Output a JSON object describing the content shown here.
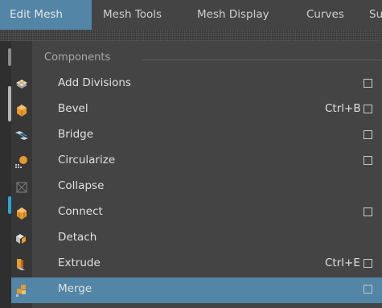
{
  "menubar": {
    "items": [
      {
        "label": "Edit Mesh",
        "active": true
      },
      {
        "label": "Mesh Tools"
      },
      {
        "label": "Mesh Display"
      },
      {
        "label": "Curves"
      },
      {
        "label": "Su"
      }
    ]
  },
  "dropdown": {
    "section_label": "Components",
    "items": [
      {
        "label": "Add Divisions",
        "shortcut": "",
        "icon": "add-divisions-icon",
        "option_box": true
      },
      {
        "label": "Bevel",
        "shortcut": "Ctrl+B",
        "icon": "bevel-icon",
        "option_box": true
      },
      {
        "label": "Bridge",
        "shortcut": "",
        "icon": "bridge-icon",
        "option_box": true
      },
      {
        "label": "Circularize",
        "shortcut": "",
        "icon": "circularize-icon",
        "option_box": true
      },
      {
        "label": "Collapse",
        "shortcut": "",
        "icon": "collapse-icon",
        "option_box": false
      },
      {
        "label": "Connect",
        "shortcut": "",
        "icon": "connect-icon",
        "option_box": true
      },
      {
        "label": "Detach",
        "shortcut": "",
        "icon": "detach-icon",
        "option_box": false
      },
      {
        "label": "Extrude",
        "shortcut": "Ctrl+E",
        "icon": "extrude-icon",
        "option_box": true
      },
      {
        "label": "Merge",
        "shortcut": "",
        "icon": "merge-icon",
        "option_box": true,
        "highlighted": true
      }
    ]
  },
  "colors": {
    "accent": "#5285a6",
    "menu_bg": "#444444",
    "icon_column": "#373737",
    "icon_orange": "#e59a2e",
    "icon_gray": "#bfbfbf"
  }
}
